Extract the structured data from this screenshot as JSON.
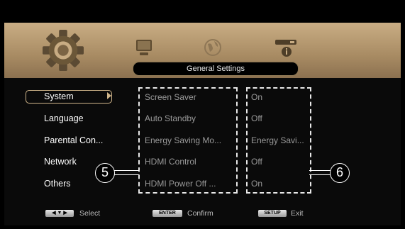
{
  "header": {
    "title": "General Settings"
  },
  "sidebar": {
    "items": [
      {
        "label": "System"
      },
      {
        "label": "Language"
      },
      {
        "label": "Parental Con..."
      },
      {
        "label": "Network"
      },
      {
        "label": "Others"
      }
    ],
    "selected": "System"
  },
  "settings": [
    {
      "label": "Screen Saver",
      "value": "On"
    },
    {
      "label": "Auto Standby",
      "value": "Off"
    },
    {
      "label": "Energy Saving Mo...",
      "value": "Energy Savi..."
    },
    {
      "label": "HDMI Control",
      "value": "Off"
    },
    {
      "label": "HDMI Power Off ...",
      "value": "On"
    }
  ],
  "callouts": {
    "left": "5",
    "right": "6"
  },
  "footer": {
    "select_key": "◀ ▼ ▶",
    "select_label": "Select",
    "enter_key": "ENTER",
    "enter_label": "Confirm",
    "setup_key": "SETUP",
    "setup_label": "Exit"
  },
  "icons": [
    "gear-icon",
    "monitor-icon",
    "globe-icon",
    "router-info-icon"
  ],
  "colors": {
    "accent": "#d0b58a",
    "band": "#b19671",
    "background": "#000000"
  }
}
